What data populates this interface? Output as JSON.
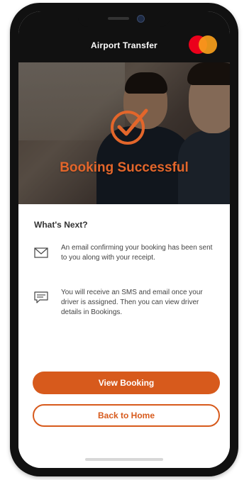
{
  "app": {
    "title": "Airport Transfer"
  },
  "hero": {
    "title": "Booking Successful"
  },
  "next_steps": {
    "heading": "What's Next?",
    "items": [
      {
        "icon": "envelope-icon",
        "text": "An email confirming your booking has been sent to you along with your receipt."
      },
      {
        "icon": "sms-chat-icon",
        "text": "You will receive an SMS and email once your driver is assigned. Then you can view driver details in Bookings."
      }
    ]
  },
  "actions": {
    "view_booking_label": "View Booking",
    "back_home_label": "Back to Home"
  },
  "colors": {
    "accent": "#d75a1c",
    "brand_red": "#eb001b",
    "brand_orange": "#f79e1b"
  }
}
